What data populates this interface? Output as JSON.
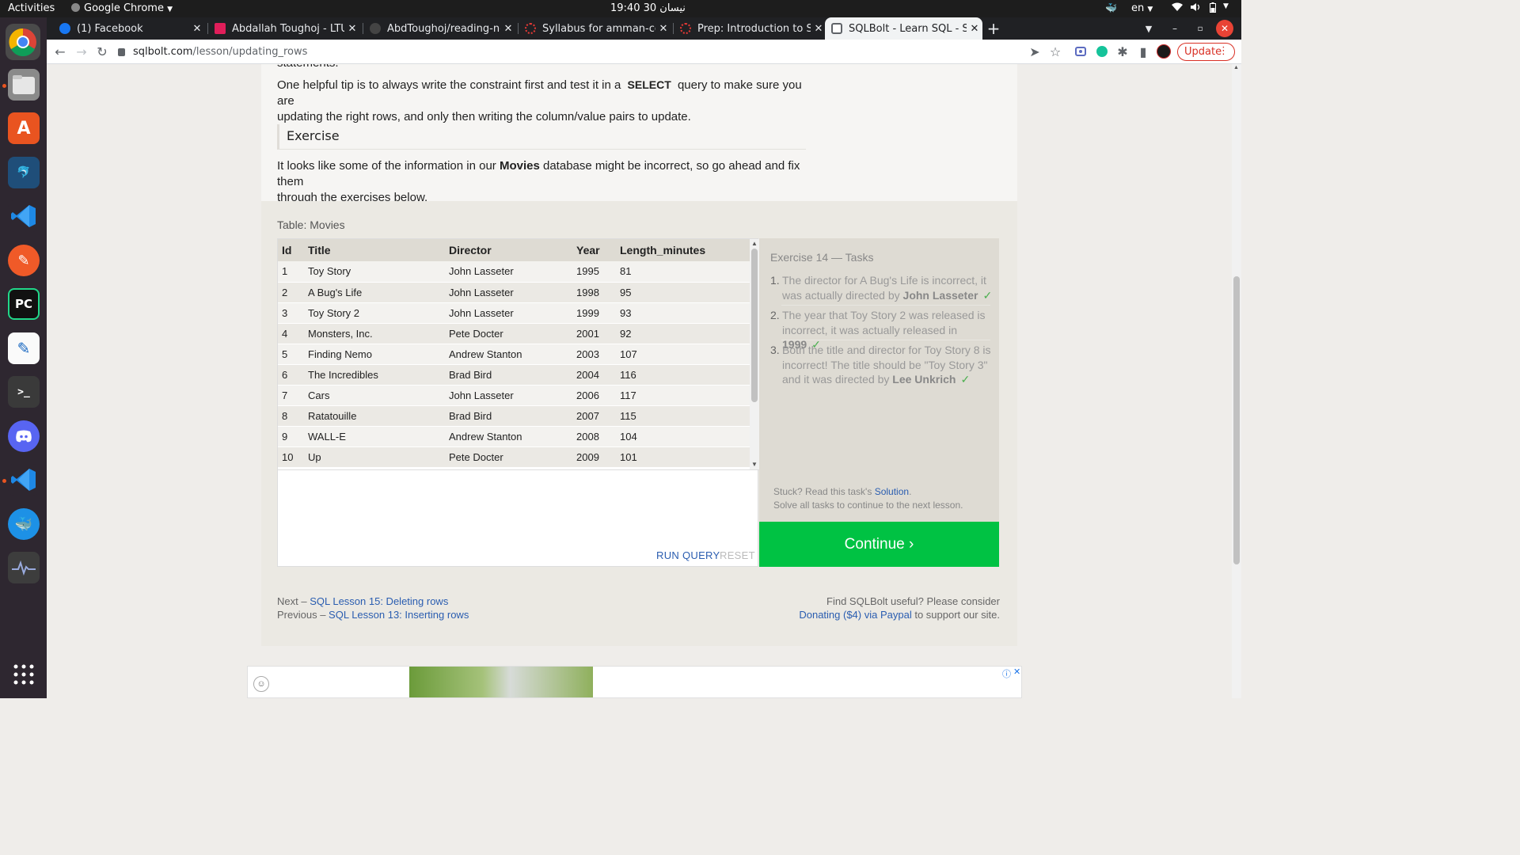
{
  "os": {
    "activities": "Activities",
    "app_name": "Google Chrome",
    "clock": "19:40  30 نيسان",
    "language": "en"
  },
  "browser": {
    "tabs": [
      {
        "title": "(1) Facebook",
        "favicon_color": "#1877f2"
      },
      {
        "title": "Abdallah Toughoj - LTUC",
        "favicon_color": "#e01e5a"
      },
      {
        "title": "AbdToughoj/reading-not",
        "favicon_color": "#444444"
      },
      {
        "title": "Syllabus for amman-code",
        "favicon_color": "#e53935"
      },
      {
        "title": "Prep: Introduction to SQL",
        "favicon_color": "#e53935"
      },
      {
        "title": "SQLBolt - Learn SQL - SQL",
        "favicon_color": "#5f6368"
      }
    ],
    "url_host": "sqlbolt.com",
    "url_path": "/lesson/updating_rows",
    "update_label": "Update"
  },
  "lesson": {
    "cut_text": "statements.",
    "tip_before": "One helpful tip is to always write the constraint first and test it in a",
    "tip_keyword": "SELECT",
    "tip_after": "query to make sure you are",
    "tip_line2": "updating the right rows, and only then writing the column/value pairs to update.",
    "exercise_heading": "Exercise",
    "intro_before": "It looks like some of the information in our",
    "intro_bold": "Movies",
    "intro_after": "database might be incorrect, so go ahead and fix them",
    "intro_line2": "through the exercises below."
  },
  "table": {
    "caption": "Table: Movies",
    "columns": [
      "Id",
      "Title",
      "Director",
      "Year",
      "Length_minutes"
    ],
    "rows": [
      [
        "1",
        "Toy Story",
        "John Lasseter",
        "1995",
        "81"
      ],
      [
        "2",
        "A Bug's Life",
        "John Lasseter",
        "1998",
        "95"
      ],
      [
        "3",
        "Toy Story 2",
        "John Lasseter",
        "1999",
        "93"
      ],
      [
        "4",
        "Monsters, Inc.",
        "Pete Docter",
        "2001",
        "92"
      ],
      [
        "5",
        "Finding Nemo",
        "Andrew Stanton",
        "2003",
        "107"
      ],
      [
        "6",
        "The Incredibles",
        "Brad Bird",
        "2004",
        "116"
      ],
      [
        "7",
        "Cars",
        "John Lasseter",
        "2006",
        "117"
      ],
      [
        "8",
        "Ratatouille",
        "Brad Bird",
        "2007",
        "115"
      ],
      [
        "9",
        "WALL-E",
        "Andrew Stanton",
        "2008",
        "104"
      ],
      [
        "10",
        "Up",
        "Pete Docter",
        "2009",
        "101"
      ]
    ]
  },
  "editor": {
    "run_label": "RUN QUERY",
    "reset_label": "RESET"
  },
  "tasks": {
    "title": "Exercise 14 — Tasks",
    "items": [
      {
        "num": "1.",
        "text": "The director for A Bug's Life is incorrect, it was actually directed by",
        "bold": "John Lasseter",
        "check": "✓"
      },
      {
        "num": "2.",
        "text": "The year that Toy Story 2 was released is incorrect, it was actually released in",
        "bold": "1999",
        "check": "✓"
      },
      {
        "num": "3.",
        "text": "Both the title and director for Toy Story 8 is incorrect! The title should be \"Toy Story 3\" and it was directed by",
        "bold": "Lee Unkrich",
        "check": "✓"
      }
    ],
    "hint_before": "Stuck? Read this task's",
    "hint_link": "Solution",
    "hint_after": ".",
    "hint_line2": "Solve all tasks to continue to the next lesson.",
    "continue_label": "Continue ›"
  },
  "footer": {
    "next_prefix": "Next –",
    "next_link": "SQL Lesson 15: Deleting rows",
    "prev_prefix": "Previous –",
    "prev_link": "SQL Lesson 13: Inserting rows",
    "support_line1": "Find SQLBolt useful? Please consider",
    "support_link": "Donating ($4) via Paypal",
    "support_after": "to support our site."
  }
}
